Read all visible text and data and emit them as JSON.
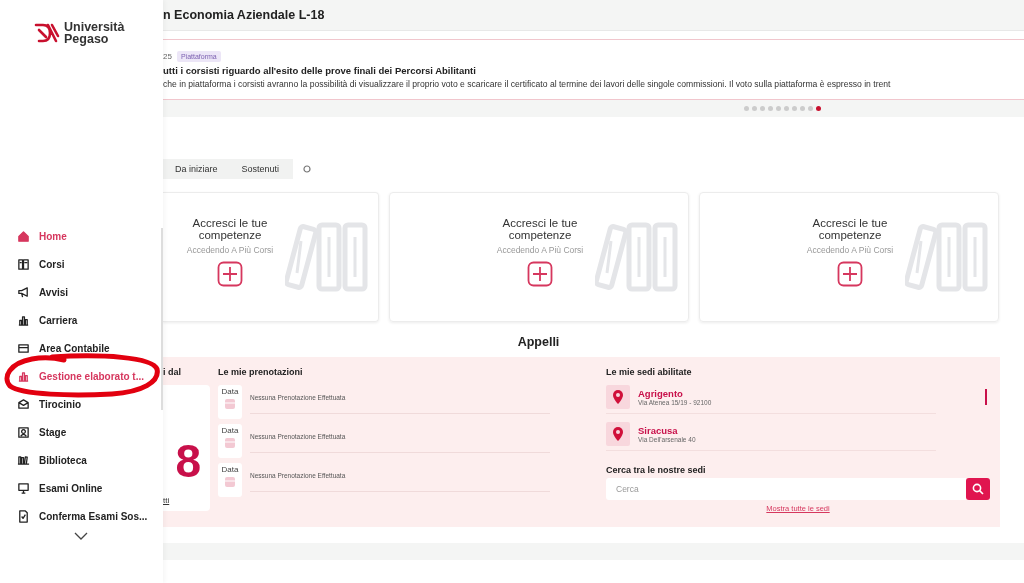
{
  "sidebar": {
    "logo_lines": [
      "Università",
      "Pegaso"
    ],
    "items": [
      {
        "label": "Home",
        "selected": true
      },
      {
        "label": "Corsi",
        "selected": false
      },
      {
        "label": "Avvisi",
        "selected": false
      },
      {
        "label": "Carriera",
        "selected": false
      },
      {
        "label": "Area Contabile",
        "selected": false
      },
      {
        "label": "Gestione elaborato t...",
        "selected": true
      },
      {
        "label": "Tirocinio",
        "selected": false
      },
      {
        "label": "Stage",
        "selected": false
      },
      {
        "label": "Biblioteca",
        "selected": false
      },
      {
        "label": "Esami Online",
        "selected": false
      },
      {
        "label": "Conferma Esami Sos...",
        "selected": false
      }
    ]
  },
  "header": {
    "title": "n Economia Aziendale L-18"
  },
  "notice": {
    "date": "25",
    "tag": "Piattaforma",
    "title": "utti i corsisti riguardo all'esito delle prove finali dei Percorsi Abilitanti",
    "body": "che in piattaforma i corsisti avranno la possibilità di visualizzare il proprio voto e scaricare il certificato al termine dei lavori delle singole commissioni. Il voto sulla piattaforma è espresso in trent"
  },
  "carousel_dots": [
    {
      "selected": false
    },
    {
      "selected": false
    },
    {
      "selected": false
    },
    {
      "selected": false
    },
    {
      "selected": false
    },
    {
      "selected": false
    },
    {
      "selected": false
    },
    {
      "selected": false
    },
    {
      "selected": false
    },
    {
      "selected": true
    }
  ],
  "tabs": [
    {
      "label": "Da iniziare",
      "selected": false
    },
    {
      "label": "Sostenuti",
      "selected": false
    }
  ],
  "cards": [
    {
      "title": "Accresci le tue competenze",
      "subtitle": "Accedendo A Più Corsi"
    },
    {
      "title": "Accresci le tue competenze",
      "subtitle": "Accedendo A Più Corsi"
    },
    {
      "title": "Accresci le tue competenze",
      "subtitle": "Accedendo A Più Corsi"
    }
  ],
  "appelli": {
    "title": "Appelli",
    "left": {
      "heading": "i dal",
      "number": "8",
      "link": "tti"
    },
    "bookings": {
      "heading": "Le mie prenotazioni",
      "rows": [
        {
          "label": "Data",
          "text": "Nessuna Prenotazione Effettuata"
        },
        {
          "label": "Data",
          "text": "Nessuna Prenotazione Effettuata"
        },
        {
          "label": "Data",
          "text": "Nessuna Prenotazione Effettuata"
        }
      ]
    },
    "sedi": {
      "heading": "Le mie sedi abilitate",
      "items": [
        {
          "name": "Agrigento",
          "address": "Via Atenea 15/19 - 92100"
        },
        {
          "name": "Siracusa",
          "address": "Via Dell'arsenale 40"
        }
      ],
      "search_heading": "Cerca tra le nostre sedi",
      "search": {
        "placeholder": "Cerca"
      },
      "link": "Mostra tutte le sedi"
    }
  }
}
